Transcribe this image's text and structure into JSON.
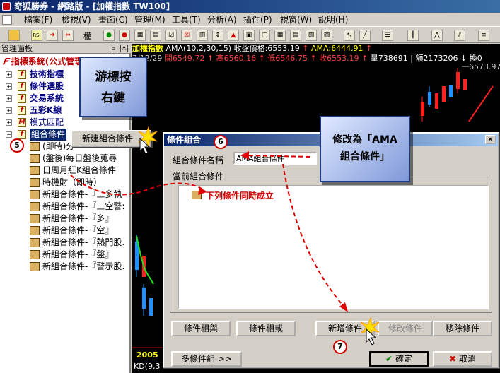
{
  "window": {
    "title": "奇狐勝券 - 網路版 - [加權指數 TW100]"
  },
  "menu": [
    "檔案(F)",
    "檢視(V)",
    "畫面(C)",
    "管理(M)",
    "工具(T)",
    "分析(A)",
    "插件(P)",
    "視窗(W)",
    "說明(H)"
  ],
  "toolbar": {
    "rsi_label": "RSI",
    "weight_label": "權"
  },
  "panel": {
    "title": "管理面板",
    "items": [
      {
        "label": "指標系統(公式管理)"
      },
      {
        "label": "技術指標"
      },
      {
        "label": "條件選股"
      },
      {
        "label": "交易系統"
      },
      {
        "label": "五彩K線"
      },
      {
        "label": "模式匹配"
      },
      {
        "label": "組合條件"
      }
    ],
    "children": [
      "(即時)分",
      "(盤後)每日盤後蒐尋",
      "日周月紅K組合條件",
      "時機財（即時）",
      "新組合條件-『三多執",
      "新組合條件-『三空警:",
      "新組合條件-『多』",
      "新組合條件-『空』",
      "新組合條件-『熱門股.",
      "新組合條件-『盤』",
      "新組合條件-『警示股."
    ]
  },
  "context_menu": {
    "item": "新建組合條件"
  },
  "chart": {
    "row1": {
      "name": "加權指數",
      "ama_text": "AMA(10,2,30,15) 收盤價格:6553.19",
      "ama_value": "AMA:6444.91"
    },
    "row2": {
      "date": "7/12/29",
      "open": "開6549.72",
      "high": "高6560.16",
      "low": "低6546.75",
      "close": "收6553.19",
      "volume": "量738691",
      "amount": "額2173206",
      "turnover": "換0"
    },
    "price_label": "6573.97",
    "year_label": "2005",
    "kd_label": "KD(9,3"
  },
  "dialog": {
    "title": "條件組合",
    "name_label": "組合條件名稱",
    "name_value": "AMA組合條件",
    "group_label": "當前組合條件",
    "root_node": "下列條件同時成立",
    "buttons": {
      "and": "條件相與",
      "or": "條件相或",
      "add": "新增條件",
      "modify": "修改條件",
      "remove": "移除條件",
      "multi": "多條件組 >>",
      "ok": "確定",
      "cancel": "取消"
    }
  },
  "callouts": {
    "right_click": "游標按右鍵",
    "rename_line1": "修改為「AMA",
    "rename_line2": "組合條件」"
  },
  "steps": {
    "five": "5",
    "six": "6",
    "seven": "7"
  }
}
